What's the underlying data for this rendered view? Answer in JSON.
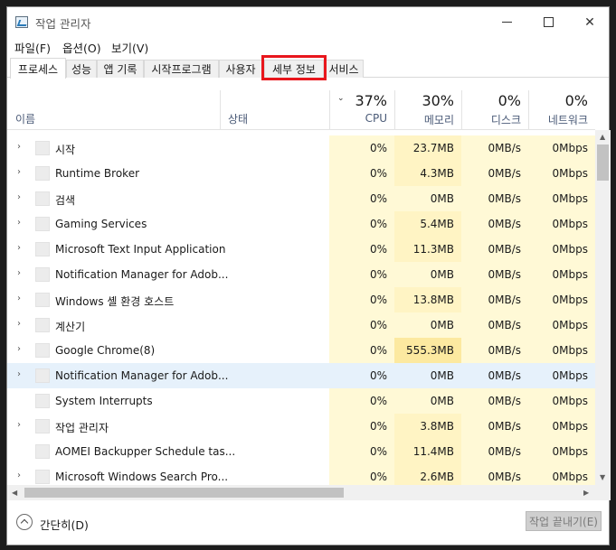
{
  "window": {
    "title": "작업 관리자",
    "controls": {
      "minimize": "",
      "maximize": "",
      "close": "✕"
    }
  },
  "menu": [
    "파일(F)",
    "옵션(O)",
    "보기(V)"
  ],
  "tabs": [
    "프로세스",
    "성능",
    "앱 기록",
    "시작프로그램",
    "사용자",
    "세부 정보",
    "서비스"
  ],
  "active_tab": "프로세스",
  "highlighted_tab": "세부 정보",
  "columns": {
    "name": "이름",
    "status": "상태",
    "cpu": {
      "pct": "37%",
      "label": "CPU"
    },
    "memory": {
      "pct": "30%",
      "label": "메모리"
    },
    "disk": {
      "pct": "0%",
      "label": "디스크"
    },
    "network": {
      "pct": "0%",
      "label": "네트워크"
    }
  },
  "rows": [
    {
      "name": "시작",
      "cpu": "0%",
      "mem": "23.7MB",
      "disk": "0MB/s",
      "net": "0Mbps",
      "chev": "›"
    },
    {
      "name": "Runtime Broker",
      "cpu": "0%",
      "mem": "4.3MB",
      "disk": "0MB/s",
      "net": "0Mbps",
      "chev": "›"
    },
    {
      "name": "검색",
      "cpu": "0%",
      "mem": "0MB",
      "disk": "0MB/s",
      "net": "0Mbps",
      "chev": "›"
    },
    {
      "name": "Gaming Services",
      "cpu": "0%",
      "mem": "5.4MB",
      "disk": "0MB/s",
      "net": "0Mbps",
      "chev": "›"
    },
    {
      "name": "Microsoft Text Input Application",
      "cpu": "0%",
      "mem": "11.3MB",
      "disk": "0MB/s",
      "net": "0Mbps",
      "chev": "›"
    },
    {
      "name": "Notification Manager for Adob...",
      "cpu": "0%",
      "mem": "0MB",
      "disk": "0MB/s",
      "net": "0Mbps",
      "chev": "›"
    },
    {
      "name": "Windows 셸 환경 호스트",
      "cpu": "0%",
      "mem": "13.8MB",
      "disk": "0MB/s",
      "net": "0Mbps",
      "chev": "›"
    },
    {
      "name": "계산기",
      "cpu": "0%",
      "mem": "0MB",
      "disk": "0MB/s",
      "net": "0Mbps",
      "chev": "›"
    },
    {
      "name": "Google Chrome(8)",
      "cpu": "0%",
      "mem": "555.3MB",
      "disk": "0MB/s",
      "net": "0Mbps",
      "chev": "›"
    },
    {
      "name": "Notification Manager for Adob...",
      "cpu": "0%",
      "mem": "0MB",
      "disk": "0MB/s",
      "net": "0Mbps",
      "chev": "›"
    },
    {
      "name": "System Interrupts",
      "cpu": "0%",
      "mem": "0MB",
      "disk": "0MB/s",
      "net": "0Mbps",
      "chev": ""
    },
    {
      "name": "작업 관리자",
      "cpu": "0%",
      "mem": "3.8MB",
      "disk": "0MB/s",
      "net": "0Mbps",
      "chev": "›"
    },
    {
      "name": "AOMEI Backupper Schedule tas...",
      "cpu": "0%",
      "mem": "11.4MB",
      "disk": "0MB/s",
      "net": "0Mbps",
      "chev": ""
    },
    {
      "name": "Microsoft Windows Search Pro...",
      "cpu": "0%",
      "mem": "2.6MB",
      "disk": "0MB/s",
      "net": "0Mbps",
      "chev": "›"
    }
  ],
  "selected_row_index": 9,
  "footer": {
    "collapse_label": "간단히(D)",
    "end_task_label": "작업 끝내기(E)"
  },
  "colors": {
    "highlight": "#e8161c",
    "selected": "#e6f1fb",
    "heat_light": "#fff9d6",
    "heat_strong": "#fce9a0"
  }
}
